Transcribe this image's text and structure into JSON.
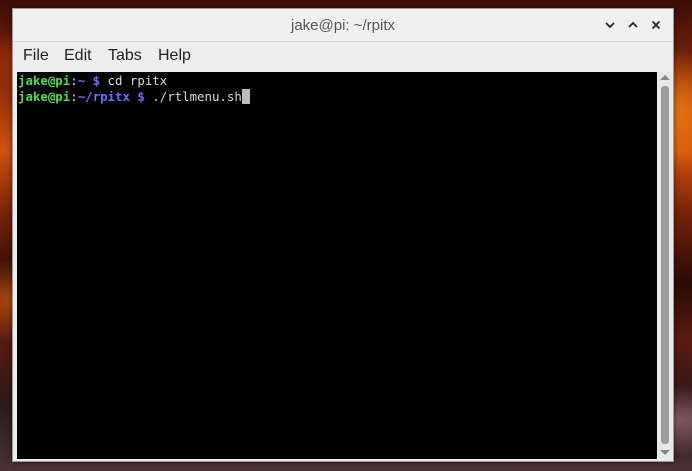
{
  "window": {
    "title": "jake@pi: ~/rpitx"
  },
  "titlebar_buttons": [
    {
      "icon": "minimize-icon",
      "glyph": "⌄"
    },
    {
      "icon": "maximize-icon",
      "glyph": "⌃"
    },
    {
      "icon": "close-icon",
      "glyph": "✕"
    }
  ],
  "menu": {
    "file": "File",
    "edit": "Edit",
    "tabs": "Tabs",
    "help": "Help"
  },
  "terminal": {
    "lines": [
      {
        "user": "jake@pi",
        "colon": ":",
        "path": "~ $",
        "command": " cd rpitx"
      },
      {
        "user": "jake@pi",
        "colon": ":",
        "path": "~/rpitx $",
        "command": " ./rtlmenu.sh"
      }
    ]
  },
  "colors": {
    "prompt_user": "#4fdc47",
    "prompt_path": "#6e6efc",
    "terminal_bg": "#000000",
    "text": "#d8d8d8"
  }
}
